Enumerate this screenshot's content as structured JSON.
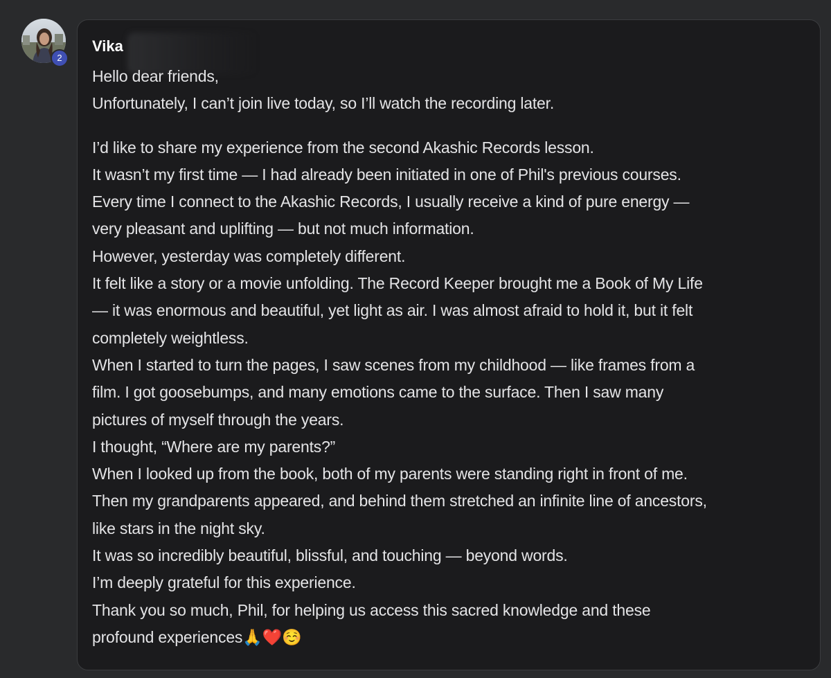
{
  "sender": {
    "name": "Vika",
    "badge_count": "2"
  },
  "message": {
    "greeting_lines": [
      "Hello dear friends,",
      "Unfortunately, I can’t join live today, so I’ll watch the recording later."
    ],
    "body_lines": [
      "I’d like to share my experience from the second Akashic Records lesson.",
      "It wasn’t my first time — I had already been initiated in one of Phil's previous courses.",
      "Every time I connect to the Akashic Records, I usually receive a kind of pure energy —",
      "very pleasant and uplifting — but not much information.",
      "However, yesterday was completely different.",
      "It felt like a story or a movie unfolding. The Record Keeper brought me a Book of My Life",
      "— it was enormous and beautiful, yet light as air. I was almost afraid to hold it, but it felt",
      "completely weightless.",
      "When I started to turn the pages, I saw scenes from my childhood — like frames from a",
      "film. I got goosebumps, and many emotions came to the surface. Then I saw many",
      "pictures of myself through the years.",
      "I thought, “Where are my parents?”",
      "When I looked up from the book, both of my parents were standing right in front of me.",
      "Then my grandparents appeared, and behind them stretched an infinite line of ancestors,",
      "like stars in the night sky.",
      "It was so incredibly beautiful, blissful, and touching — beyond words.",
      "I’m deeply grateful for this experience.",
      "Thank you so much, Phil, for helping us access this sacred knowledge and these",
      "profound experiences🙏❤️☺️"
    ]
  },
  "colors": {
    "page_background": "#292a2c",
    "card_background": "#1b1b1d",
    "text": "#e4e4e6",
    "badge": "#3f4fb3"
  },
  "icons": {
    "avatar": "user-photo",
    "badge": "notification-count-badge"
  }
}
